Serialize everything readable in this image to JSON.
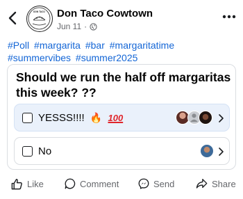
{
  "header": {
    "page_name": "Don Taco Cowtown",
    "date": "Jun 11",
    "separator": "·",
    "logo_text": "DON TACO"
  },
  "hashtags": [
    "#Poll",
    "#margarita",
    "#bar",
    "#margaritatime",
    "#summervibes",
    "#summer2025"
  ],
  "poll": {
    "question": "Should we run the half off margaritas this week? ??",
    "options": [
      {
        "label": "YESSS!!!!",
        "emoji_fire": "🔥",
        "emoji_hundred": "100"
      },
      {
        "label": "No"
      }
    ]
  },
  "actions": {
    "like": "Like",
    "comment": "Comment",
    "send": "Send",
    "share": "Share"
  },
  "colors": {
    "accent": "#1466d6",
    "secondary_text": "#65676b",
    "option_selected_bg": "#eaf1fb"
  }
}
